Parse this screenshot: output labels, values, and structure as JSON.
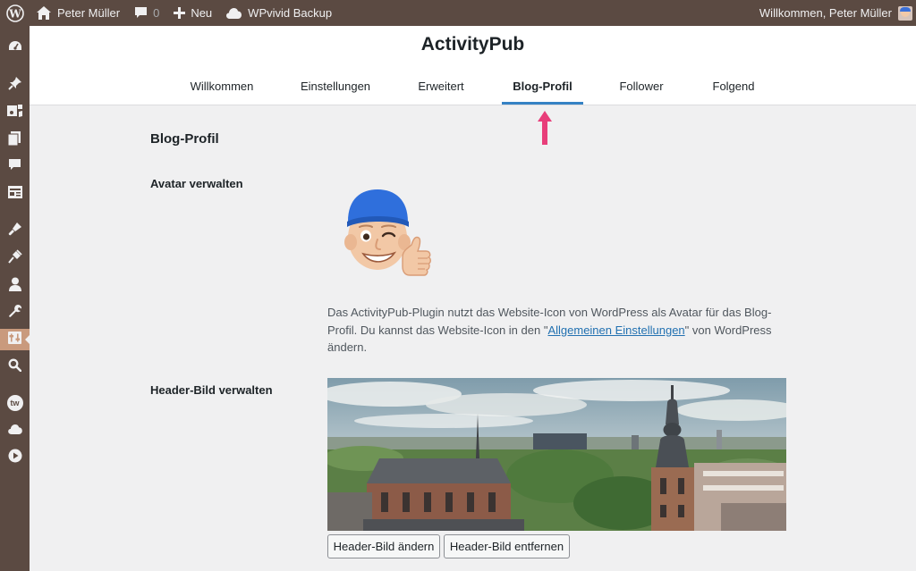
{
  "adminbar": {
    "site_name": "Peter Müller",
    "comments_count": "0",
    "new_label": "Neu",
    "backup_label": "WPvivid Backup",
    "greeting": "Willkommen, Peter Müller"
  },
  "sidebar": {
    "icons": [
      "dashboard-icon",
      "pin-icon",
      "media-icon",
      "pages-icon",
      "comments-icon",
      "forms-icon",
      "appearance-icon",
      "plugins-icon",
      "users-icon",
      "tools-icon",
      "settings-icon",
      "search-icon",
      "tw-icon",
      "cloud-icon",
      "play-icon"
    ],
    "active_index": 10,
    "tw_badge": "tw"
  },
  "page": {
    "title": "ActivityPub",
    "tabs": [
      {
        "label": "Willkommen"
      },
      {
        "label": "Einstellungen"
      },
      {
        "label": "Erweitert"
      },
      {
        "label": "Blog-Profil",
        "active": true
      },
      {
        "label": "Follower"
      },
      {
        "label": "Folgend"
      }
    ]
  },
  "content": {
    "section_title": "Blog-Profil",
    "avatar_label": "Avatar verwalten",
    "avatar_desc_before": "Das ActivityPub-Plugin nutzt das Website-Icon von WordPress als Avatar für das Blog-Profil. Du kannst das Website-Icon in den \"",
    "avatar_desc_link": "Allgemeinen Einstellungen",
    "avatar_desc_after": "\" von WordPress ändern.",
    "header_label": "Header-Bild verwalten",
    "change_button": "Header-Bild ändern",
    "remove_button": "Header-Bild entfernen"
  },
  "colors": {
    "admin_bar": "#5b4a42",
    "active_menu": "#c99a7d",
    "tab_underline": "#3582c4",
    "arrow": "#e83e7a",
    "link": "#2271b1"
  }
}
